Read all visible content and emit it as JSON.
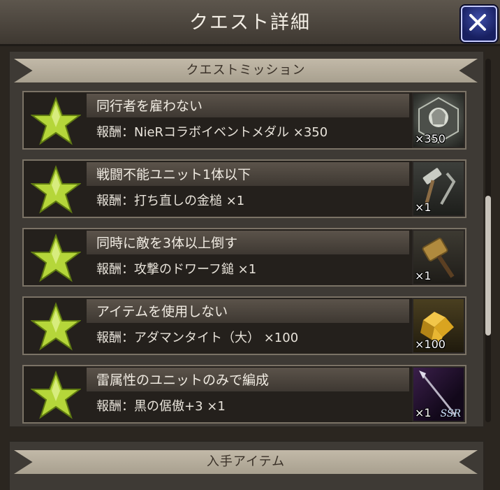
{
  "header": {
    "title": "クエスト詳細"
  },
  "missions_section": {
    "title": "クエストミッション"
  },
  "missions": [
    {
      "title": "同行者を雇わない",
      "reward": "報酬：NieRコラボイベントメダル ×350",
      "qty": "×350",
      "icon": "medal-icon"
    },
    {
      "title": "戦闘不能ユニット1体以下",
      "reward": "報酬：打ち直しの金槌 ×1",
      "qty": "×1",
      "icon": "hammer-icon"
    },
    {
      "title": "同時に敵を3体以上倒す",
      "reward": "報酬：攻撃のドワーフ鎚 ×1",
      "qty": "×1",
      "icon": "dwarf-hammer-icon"
    },
    {
      "title": "アイテムを使用しない",
      "reward": "報酬：アダマンタイト（大） ×100",
      "qty": "×100",
      "icon": "adamantite-icon"
    },
    {
      "title": "雷属性のユニットのみで編成",
      "reward": "報酬：黒の倨傲+3 ×1",
      "qty": "×1",
      "icon": "spear-icon",
      "rarity": "SSR"
    }
  ],
  "items_section": {
    "title": "入手アイテム"
  }
}
